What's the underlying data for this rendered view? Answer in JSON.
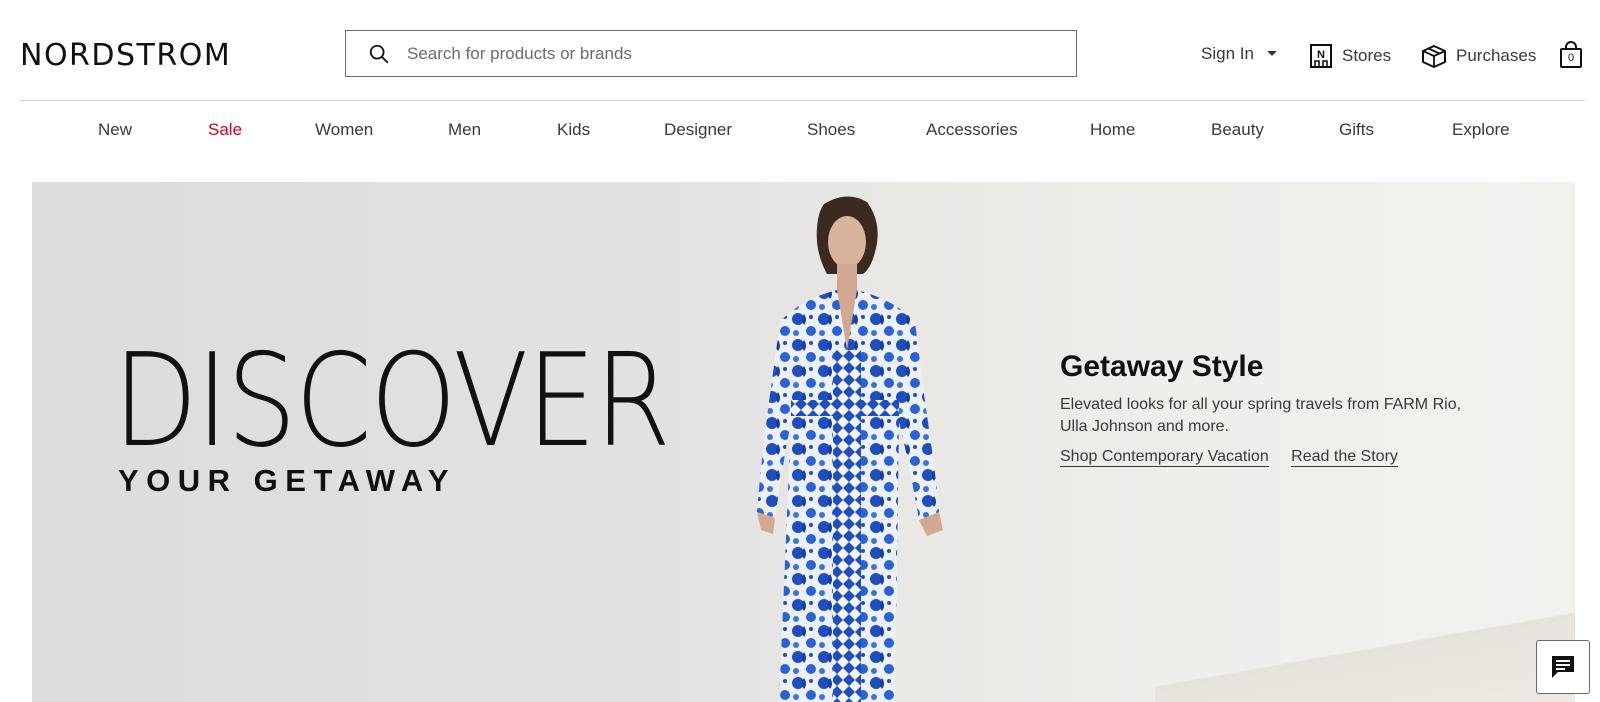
{
  "header": {
    "logo": "NORDSTROM",
    "search_placeholder": "Search for products or brands",
    "sign_in": "Sign In",
    "stores": "Stores",
    "purchases": "Purchases",
    "bag_count": "0"
  },
  "nav": {
    "items": [
      "New",
      "Sale",
      "Women",
      "Men",
      "Kids",
      "Designer",
      "Shoes",
      "Accessories",
      "Home",
      "Beauty",
      "Gifts",
      "Explore"
    ],
    "sale_color": "#d0021b"
  },
  "hero": {
    "headline": "DISCOVER",
    "subheadline": "YOUR GETAWAY",
    "promo_title": "Getaway Style",
    "promo_text": "Elevated looks for all your spring travels from FARM Rio, Ulla Johnson and more.",
    "link_1": "Shop Contemporary Vacation",
    "link_2": "Read the Story"
  },
  "colors": {
    "text": "#393939",
    "accent_sale": "#d0021b",
    "dress_blue": "#1f4fbf"
  },
  "icons": [
    "search-icon",
    "chevron-down-icon",
    "store-icon",
    "box-icon",
    "bag-icon",
    "chat-icon"
  ]
}
